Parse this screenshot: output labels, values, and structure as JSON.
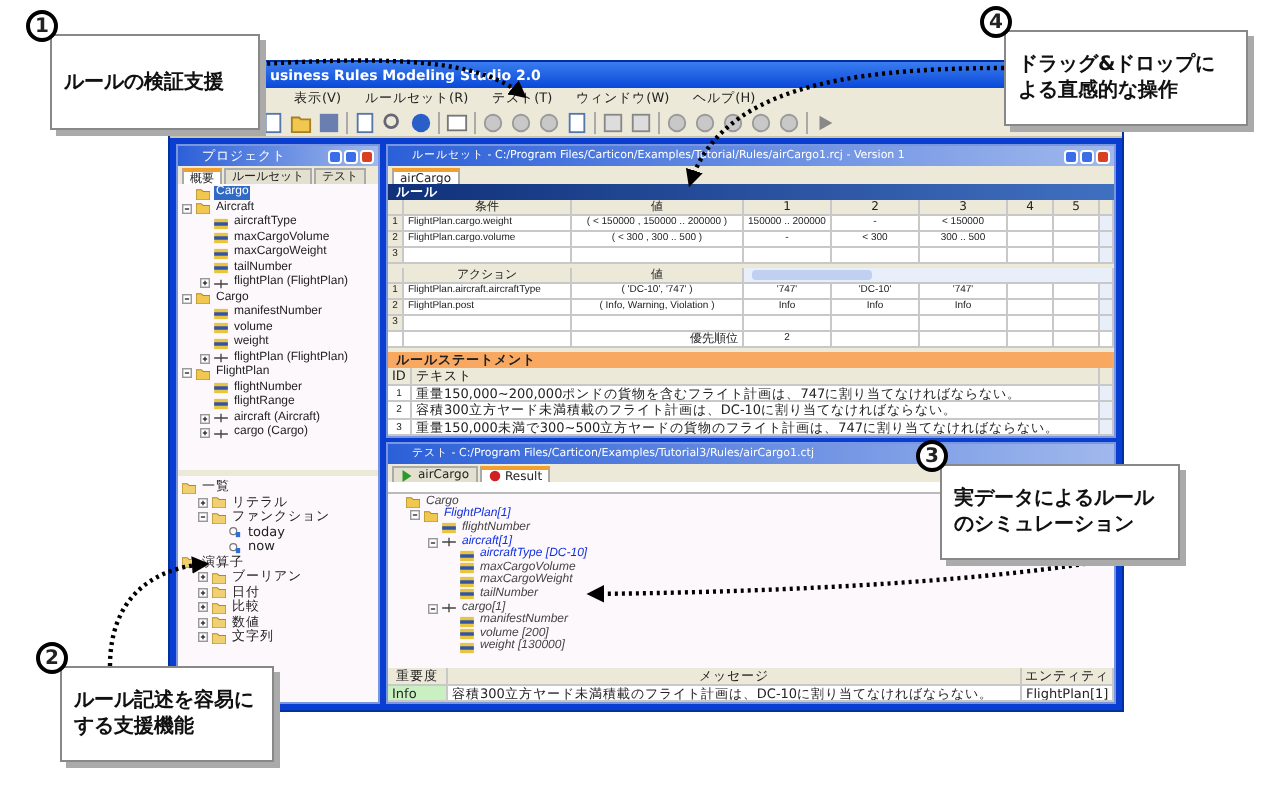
{
  "window": {
    "title": "usiness Rules Modeling Studio 2.0"
  },
  "menu": [
    "表示(V)",
    "ルールセット(R)",
    "テスト(T)",
    "ウィンドウ(W)",
    "ヘルプ(H)"
  ],
  "project_panel": {
    "title": "プロジェクト",
    "tabs": [
      {
        "label": "概要",
        "selected": true
      },
      {
        "label": "ルールセット",
        "selected": false
      },
      {
        "label": "テスト",
        "selected": false
      }
    ],
    "tree": [
      {
        "label": "Cargo",
        "kind": "folder",
        "selected": true
      },
      {
        "label": "Aircraft",
        "kind": "folder",
        "selected": false,
        "expanded": true,
        "children": [
          {
            "label": "aircraftType",
            "kind": "field",
            "selected": false
          },
          {
            "label": "maxCargoVolume",
            "kind": "field",
            "selected": false
          },
          {
            "label": "maxCargoWeight",
            "kind": "field",
            "selected": false
          },
          {
            "label": "tailNumber",
            "kind": "field",
            "selected": false
          },
          {
            "label": "flightPlan (FlightPlan)",
            "kind": "link",
            "selected": false,
            "expanded": false
          }
        ]
      },
      {
        "label": "Cargo",
        "kind": "folder",
        "selected": false,
        "expanded": true,
        "children": [
          {
            "label": "manifestNumber",
            "kind": "field",
            "selected": false
          },
          {
            "label": "volume",
            "kind": "field",
            "selected": false
          },
          {
            "label": "weight",
            "kind": "field",
            "selected": false
          },
          {
            "label": "flightPlan (FlightPlan)",
            "kind": "link",
            "selected": false,
            "expanded": false
          }
        ]
      },
      {
        "label": "FlightPlan",
        "kind": "folder",
        "selected": false,
        "expanded": true,
        "children": [
          {
            "label": "flightNumber",
            "kind": "field",
            "selected": false
          },
          {
            "label": "flightRange",
            "kind": "field",
            "selected": false
          },
          {
            "label": "aircraft (Aircraft)",
            "kind": "link",
            "selected": false,
            "expanded": false
          },
          {
            "label": "cargo (Cargo)",
            "kind": "link",
            "selected": false,
            "expanded": false
          }
        ]
      }
    ],
    "palette": [
      {
        "label": "一覧",
        "kind": "folder",
        "children": [
          {
            "label": "リテラル",
            "kind": "folder",
            "expanded": false
          },
          {
            "label": "ファンクション",
            "kind": "folder",
            "expanded": true,
            "children": [
              {
                "label": "today",
                "kind": "function"
              },
              {
                "label": "now",
                "kind": "function"
              }
            ]
          }
        ]
      },
      {
        "label": "演算子",
        "kind": "folder",
        "children": [
          {
            "label": "ブーリアン",
            "kind": "folder",
            "expanded": false
          },
          {
            "label": "日付",
            "kind": "folder",
            "expanded": false
          },
          {
            "label": "比較",
            "kind": "folder",
            "expanded": false
          },
          {
            "label": "数値",
            "kind": "folder",
            "expanded": false
          },
          {
            "label": "文字列",
            "kind": "folder",
            "expanded": false
          }
        ]
      }
    ]
  },
  "ruleset_window": {
    "title": "ルールセット - C:/Program Files/Carticon/Examples/Tutorial/Rules/airCargo1.rcj - Version 1",
    "tab": "airCargo",
    "section": "ルール",
    "conditions": {
      "columns": [
        "",
        "条件",
        "値",
        "1",
        "2",
        "3",
        "4",
        "5"
      ],
      "rows": [
        [
          "1",
          "FlightPlan.cargo.weight",
          "( < 150000 , 150000 .. 200000 )",
          "150000 .. 200000",
          "-",
          "< 150000"
        ],
        [
          "2",
          "FlightPlan.cargo.volume",
          "( < 300 , 300 .. 500 )",
          "-",
          "< 300",
          "300 .. 500"
        ],
        [
          "3"
        ]
      ]
    },
    "actions": {
      "columns": [
        "",
        "アクション",
        "値"
      ],
      "rows": [
        [
          "1",
          "FlightPlan.aircraft.aircraftType",
          "( 'DC-10', '747' )",
          "'747'",
          "'DC-10'",
          "'747'"
        ],
        [
          "2",
          "FlightPlan.post",
          "( Info, Warning, Violation )",
          "Info",
          "Info",
          "Info"
        ],
        [
          "3"
        ]
      ]
    },
    "priority": {
      "label": "優先順位",
      "values": [
        "2"
      ]
    },
    "statements": {
      "title": "ルールステートメント",
      "columns": [
        "ID",
        "テキスト"
      ],
      "rows": [
        [
          "1",
          "重量150,000~200,000ポンドの貨物を含むフライト計画は、747に割り当てなければならない。"
        ],
        [
          "2",
          "容積300立方ヤード未満積載のフライト計画は、DC-10に割り当てなければならない。"
        ],
        [
          "3",
          "重量150,000未満で300~500立方ヤードの貨物のフライト計画は、747に割り当てなければならない。"
        ]
      ]
    }
  },
  "test_window": {
    "title": "テスト - C:/Program Files/Carticon/Examples/Tutorial3/Rules/airCargo1.ctj",
    "tabs": [
      {
        "label": "airCargo",
        "kind": "play",
        "selected": false
      },
      {
        "label": "Result",
        "kind": "stop",
        "selected": true
      }
    ],
    "tree": [
      {
        "label": "Cargo",
        "kind": "folder",
        "modified": false,
        "children": [
          {
            "label": "FlightPlan[1]",
            "kind": "folder",
            "modified": true,
            "expanded": true,
            "children": [
              {
                "label": "flightNumber",
                "kind": "field",
                "modified": false
              },
              {
                "label": "aircraft[1]",
                "kind": "link",
                "modified": true,
                "expanded": true,
                "children": [
                  {
                    "label": "aircraftType [DC-10]",
                    "kind": "field",
                    "modified": true
                  },
                  {
                    "label": "maxCargoVolume",
                    "kind": "field",
                    "modified": false
                  },
                  {
                    "label": "maxCargoWeight",
                    "kind": "field",
                    "modified": false
                  },
                  {
                    "label": "tailNumber",
                    "kind": "field",
                    "modified": false
                  }
                ]
              },
              {
                "label": "cargo[1]",
                "kind": "link",
                "modified": false,
                "expanded": true,
                "children": [
                  {
                    "label": "manifestNumber",
                    "kind": "field",
                    "modified": false
                  },
                  {
                    "label": "volume [200]",
                    "kind": "field",
                    "modified": false
                  },
                  {
                    "label": "weight [130000]",
                    "kind": "field",
                    "modified": false
                  }
                ]
              }
            ]
          }
        ]
      }
    ],
    "messages": {
      "columns": [
        "重要度",
        "メッセージ",
        "エンティティ"
      ],
      "rows": [
        [
          "Info",
          "容積300立方ヤード未満積載のフライト計画は、DC-10に割り当てなければならない。",
          "FlightPlan[1]"
        ]
      ]
    }
  },
  "callouts": [
    {
      "number": "1",
      "text": "ルールの検証支援"
    },
    {
      "number": "4",
      "text": "ドラッグ&ドロップによる直感的な操作"
    },
    {
      "number": "3",
      "text": "実データによるルールのシミュレーション"
    },
    {
      "number": "2",
      "text": "ルール記述を容易にする支援機能"
    }
  ]
}
